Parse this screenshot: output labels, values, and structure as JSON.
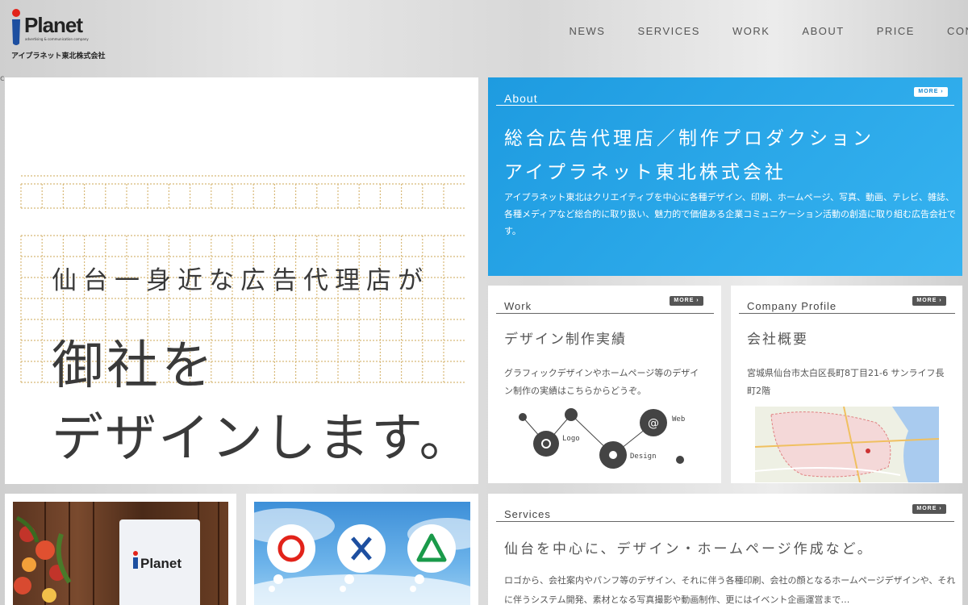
{
  "brand": {
    "name": "Planet",
    "tagline": "advertising & communication company",
    "company_jp": "アイプラネット東北株式会社"
  },
  "nav": [
    "NEWS",
    "SERVICES",
    "WORK",
    "ABOUT",
    "PRICE",
    "CONTA"
  ],
  "stray_char": "c",
  "hero": {
    "line1": "仙台一身近な広告代理店が",
    "line2": "御社を",
    "line3": "デザインします。"
  },
  "more_label": "MORE",
  "about": {
    "heading": "About",
    "title1": "総合広告代理店／制作プロダクション",
    "title2": "アイプラネット東北株式会社",
    "body": "アイプラネット東北はクリエイティブを中心に各種デザイン、印刷、ホームページ、写真、動画、テレビ、雑誌、各種メディアなど総合的に取り扱い、魅力的で価値ある企業コミュニケーション活動の創造に取り組む広告会社です。"
  },
  "work": {
    "heading": "Work",
    "title": "デザイン制作実績",
    "body": "グラフィックデザインやホームページ等のデザイン制作の実績はこちらからどうぞ。",
    "diagram_labels": [
      "Logo",
      "Web",
      "Design"
    ]
  },
  "company": {
    "heading": "Company Profile",
    "title": "会社概要",
    "address": "宮城県仙台市太白区長町8丁目21-6 サンライフ長町2階"
  },
  "services": {
    "heading": "Services",
    "title": "仙台を中心に、デザイン・ホームページ作成など。",
    "body": "ロゴから、会社案内やパンフ等のデザイン、それに伴う各種印刷、会社の顔となるホームページデザインや、それに伴うシステム開発、素材となる写真撮影や動画制作、更にはイベント企画運営まで…"
  },
  "photo1": {
    "sign_text": "Planet"
  },
  "colors": {
    "accent": "#1e9be0",
    "text": "#555555",
    "background": "#dcdcdc",
    "nav": "#555555"
  }
}
